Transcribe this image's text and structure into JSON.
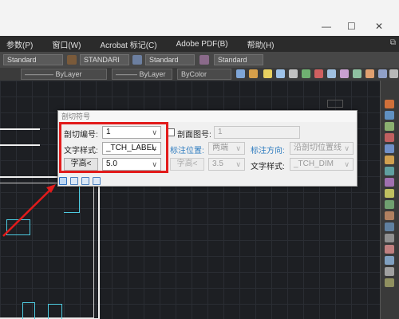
{
  "window": {
    "minimize_glyph": "—",
    "maximize_glyph": "☐",
    "close_glyph": "✕"
  },
  "menubar": {
    "items": [
      "参数(P)",
      "窗口(W)",
      "Acrobat 标记(C)",
      "Adobe PDF(B)",
      "帮助(H)"
    ],
    "end_glyph": "⧉"
  },
  "toolbar_styles": {
    "field1": "Standard",
    "field2": "STANDARI",
    "field3": "Standard",
    "field4": "Standard"
  },
  "toolbar_properties": {
    "linetype1": "———— ByLayer",
    "linetype2": "——— ByLayer",
    "color": "ByColor"
  },
  "dialog": {
    "title": "剖切符号",
    "section_number_label": "剖切编号:",
    "section_number_value": "1",
    "text_style_label": "文字样式:",
    "text_style_value": "_TCH_LABEL",
    "text_height_button": "字高<",
    "text_height_value": "5.0",
    "section_drawing_label": "剖面图号:",
    "section_drawing_value": "1",
    "annotation_position_label": "标注位置:",
    "annotation_position_value": "两端",
    "annotation_direction_label": "标注方向:",
    "annotation_direction_value": "沿剖切位置线",
    "text_height2_button": "字高<",
    "text_height2_value": "3.5",
    "text_style2_label": "文字样式:",
    "text_style2_value": "_TCH_DIM",
    "checkbox_checked": false
  },
  "colors": {
    "highlight": "#e21b1b",
    "arrow": "#e21b1b",
    "blue_label": "#2d7bbf"
  }
}
